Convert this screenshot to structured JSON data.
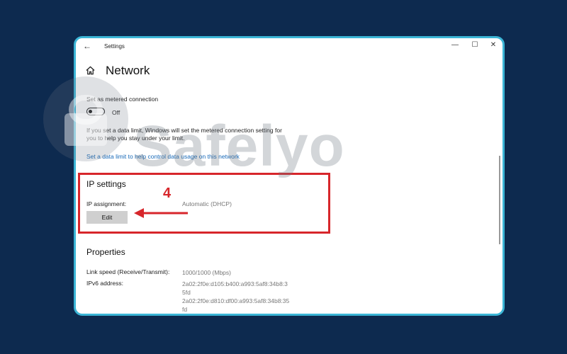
{
  "window": {
    "title": "Settings",
    "back_icon": "←",
    "minimize_icon": "—",
    "maximize_icon": "☐",
    "close_icon": "✕"
  },
  "page": {
    "title": "Network"
  },
  "metered": {
    "label": "Set as metered connection",
    "toggle_state": "Off",
    "description": "If you set a data limit, Windows will set the metered connection setting for you to help you stay under your limit.",
    "link": "Set a data limit to help control data usage on this network"
  },
  "ip_settings": {
    "heading": "IP settings",
    "assignment_label": "IP assignment:",
    "assignment_value": "Automatic (DHCP)",
    "edit_button": "Edit"
  },
  "annotation": {
    "step_number": "4",
    "color": "#d7262b"
  },
  "properties": {
    "heading": "Properties",
    "rows": [
      {
        "label": "Link speed (Receive/Transmit):",
        "values": [
          "1000/1000 (Mbps)"
        ]
      },
      {
        "label": "IPv6 address:",
        "values": [
          "2a02:2f0e:d105:b400:a993:5af8:34b8:3",
          "5fd",
          "2a02:2f0e:d810:df00:a993:5af8:34b8:35",
          "fd"
        ]
      }
    ]
  },
  "watermark": {
    "text": "Safelyo"
  },
  "colors": {
    "background": "#0d2a4f",
    "window_border": "#3bb5d6",
    "link": "#1769b8"
  }
}
